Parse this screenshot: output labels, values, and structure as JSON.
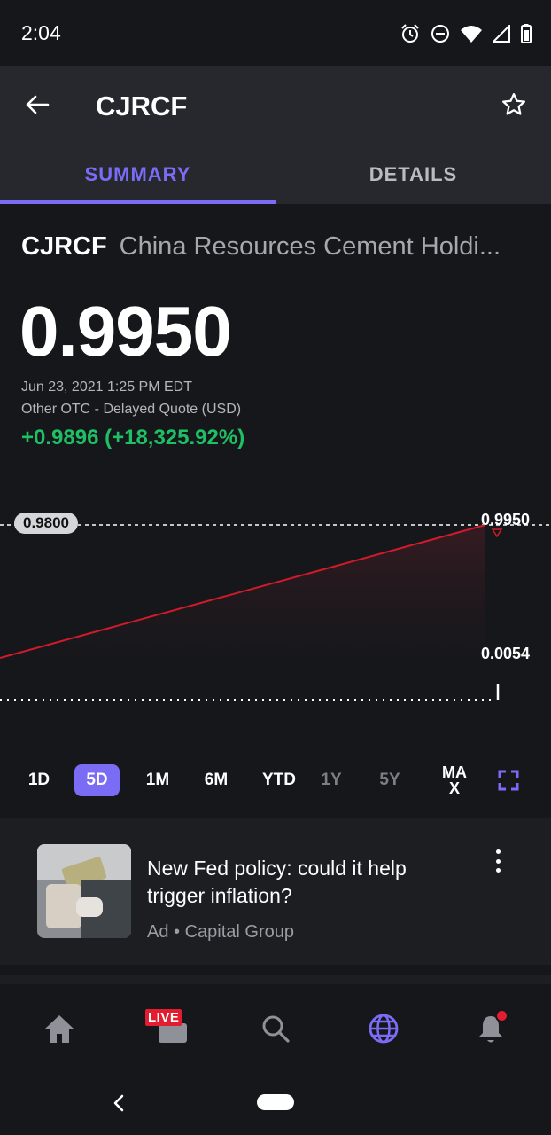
{
  "status_bar": {
    "time": "2:04",
    "icons": [
      "alarm-icon",
      "do-not-disturb-icon",
      "wifi-icon",
      "signal-icon",
      "battery-icon"
    ]
  },
  "header": {
    "title": "CJRCF",
    "icons": [
      "arrow-left-icon",
      "star-outline-icon"
    ]
  },
  "tabs": [
    {
      "label": "SUMMARY",
      "active": true
    },
    {
      "label": "DETAILS",
      "active": false
    }
  ],
  "quote": {
    "symbol": "CJRCF",
    "name": "China Resources Cement Holdi...",
    "price": "0.9950",
    "timestamp": "Jun 23, 2021 1:25 PM EDT",
    "exchange": "Other OTC - Delayed Quote (USD)",
    "change": "+0.9896 (+18,325.92%)"
  },
  "chart_data": {
    "type": "line",
    "previous_close_label": "0.9800",
    "high_label": "0.9950",
    "low_label": "0.0054",
    "colors": {
      "line": "#d11a2a",
      "background": "#15171b"
    }
  },
  "ranges": [
    {
      "label": "1D",
      "state": "normal"
    },
    {
      "label": "5D",
      "state": "active"
    },
    {
      "label": "1M",
      "state": "normal"
    },
    {
      "label": "6M",
      "state": "normal"
    },
    {
      "label": "YTD",
      "state": "normal"
    },
    {
      "label": "1Y",
      "state": "disabled"
    },
    {
      "label": "5Y",
      "state": "disabled"
    },
    {
      "label": "MAX",
      "state": "normal"
    }
  ],
  "max_label": {
    "line1": "MA",
    "line2": "X"
  },
  "ad": {
    "title": "New Fed policy: could it help trigger inflation?",
    "sponsor": "Ad • Capital Group"
  },
  "bottom_nav": {
    "live_label": "LIVE",
    "items": [
      "home-icon",
      "live-icon",
      "search-icon",
      "globe-icon",
      "bell-icon"
    ],
    "active": "globe-icon"
  },
  "colors": {
    "accent": "#7b6cf6",
    "positive": "#1fbf64",
    "negative": "#d11a2a",
    "background": "#15171b",
    "app_bar": "#26282d"
  }
}
